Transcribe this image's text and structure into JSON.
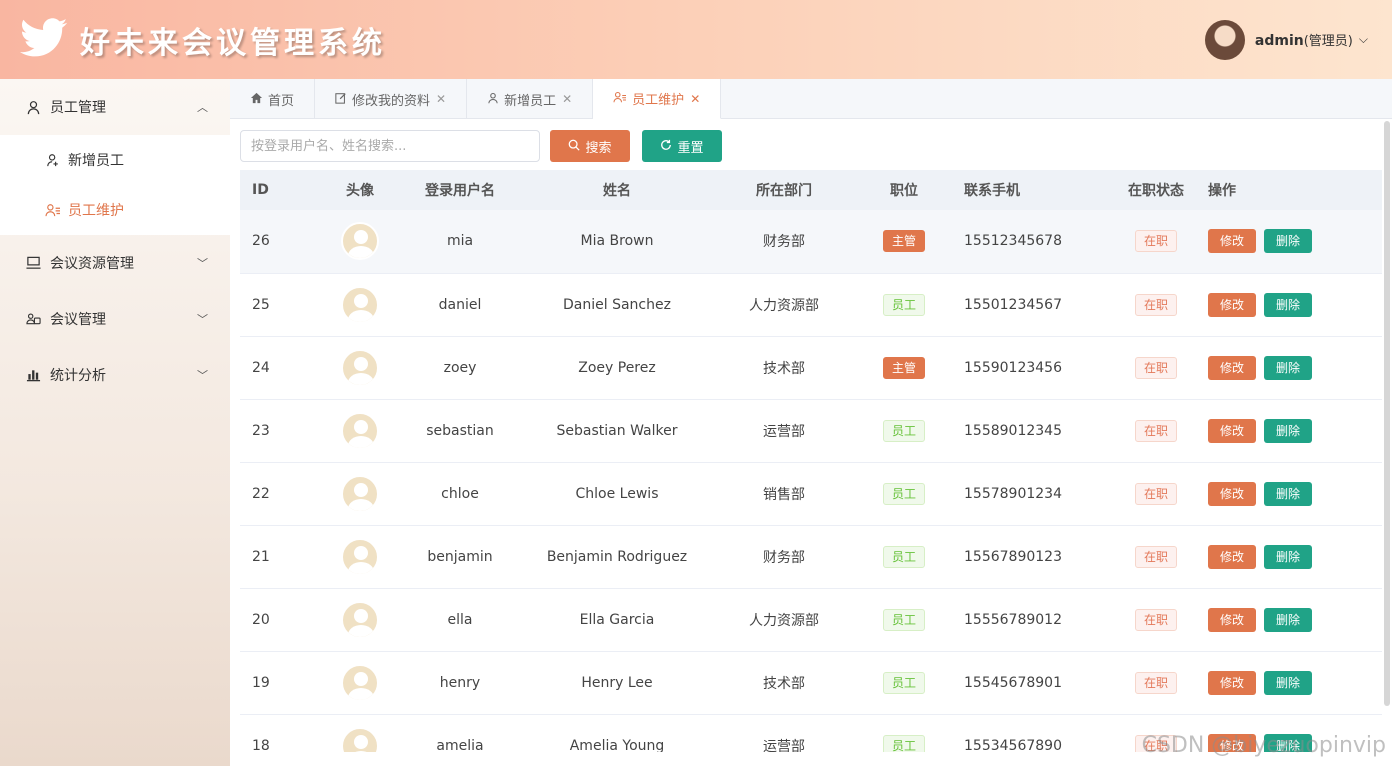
{
  "header": {
    "title": "好未来会议管理系统",
    "user_name": "admin",
    "user_role": "(管理员)"
  },
  "sidebar": {
    "groups": [
      {
        "label": "员工管理",
        "icon": "user-icon",
        "expanded": true,
        "items": [
          {
            "label": "新增员工",
            "icon": "user-add-icon"
          },
          {
            "label": "员工维护",
            "icon": "users-edit-icon",
            "active": true
          }
        ]
      },
      {
        "label": "会议资源管理",
        "icon": "monitor-icon"
      },
      {
        "label": "会议管理",
        "icon": "meeting-icon"
      },
      {
        "label": "统计分析",
        "icon": "bar-chart-icon"
      }
    ]
  },
  "tabs": [
    {
      "label": "首页",
      "icon": "home-icon",
      "closable": false
    },
    {
      "label": "修改我的资料",
      "icon": "edit-icon",
      "closable": true
    },
    {
      "label": "新增员工",
      "icon": "user-icon",
      "closable": true
    },
    {
      "label": "员工维护",
      "icon": "users-edit-icon",
      "closable": true,
      "active": true
    }
  ],
  "toolbar": {
    "search_placeholder": "按登录用户名、姓名搜索...",
    "search_label": "搜索",
    "reset_label": "重置"
  },
  "table": {
    "columns": [
      "ID",
      "头像",
      "登录用户名",
      "姓名",
      "所在部门",
      "职位",
      "联系手机",
      "在职状态",
      "操作"
    ],
    "edit_label": "修改",
    "delete_label": "删除",
    "rows": [
      {
        "id": "26",
        "username": "mia",
        "name": "Mia Brown",
        "dept": "财务部",
        "position": "主管",
        "phone": "15512345678",
        "status": "在职"
      },
      {
        "id": "25",
        "username": "daniel",
        "name": "Daniel Sanchez",
        "dept": "人力资源部",
        "position": "员工",
        "phone": "15501234567",
        "status": "在职"
      },
      {
        "id": "24",
        "username": "zoey",
        "name": "Zoey Perez",
        "dept": "技术部",
        "position": "主管",
        "phone": "15590123456",
        "status": "在职"
      },
      {
        "id": "23",
        "username": "sebastian",
        "name": "Sebastian Walker",
        "dept": "运营部",
        "position": "员工",
        "phone": "15589012345",
        "status": "在职"
      },
      {
        "id": "22",
        "username": "chloe",
        "name": "Chloe Lewis",
        "dept": "销售部",
        "position": "员工",
        "phone": "15578901234",
        "status": "在职"
      },
      {
        "id": "21",
        "username": "benjamin",
        "name": "Benjamin Rodriguez",
        "dept": "财务部",
        "position": "员工",
        "phone": "15567890123",
        "status": "在职"
      },
      {
        "id": "20",
        "username": "ella",
        "name": "Ella Garcia",
        "dept": "人力资源部",
        "position": "员工",
        "phone": "15556789012",
        "status": "在职"
      },
      {
        "id": "19",
        "username": "henry",
        "name": "Henry Lee",
        "dept": "技术部",
        "position": "员工",
        "phone": "15545678901",
        "status": "在职"
      },
      {
        "id": "18",
        "username": "amelia",
        "name": "Amelia Young",
        "dept": "运营部",
        "position": "员工",
        "phone": "15534567890",
        "status": "在职"
      }
    ]
  },
  "watermark": "CSDN @biyezuopinvip",
  "colors": {
    "accent": "#e0764b",
    "teal": "#20a387",
    "employee_tag": "#67c23a"
  }
}
